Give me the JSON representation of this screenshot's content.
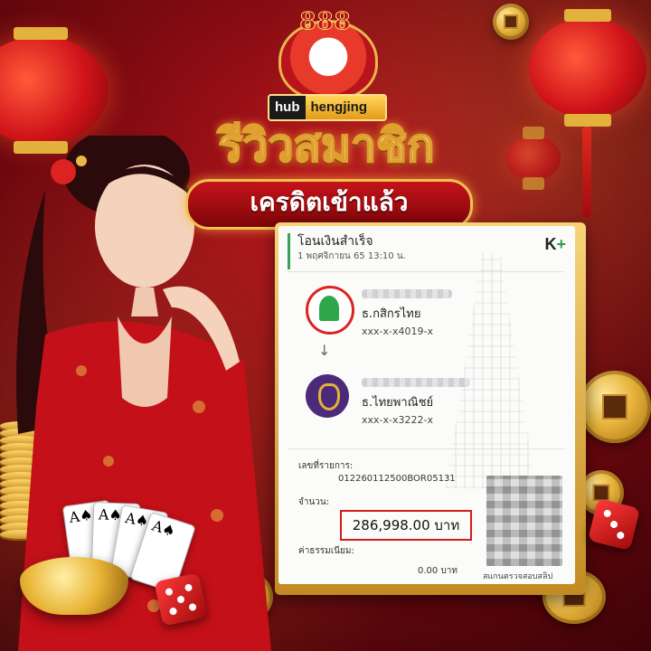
{
  "logo": {
    "badge": "888",
    "hub": "hub",
    "brand": "hengjing"
  },
  "headline": {
    "title": "รีวิวสมาชิก",
    "subtitle": "เครดิตเข้าแล้ว"
  },
  "slip": {
    "title": "โอนเงินสำเร็จ",
    "date": "1 พฤศจิกายน 65 13:10 น.",
    "app_logo": {
      "k": "K",
      "plus": "+"
    },
    "from": {
      "bank": "ธ.กสิกรไทย",
      "account": "xxx-x-x4019-x",
      "icon": "kasikorn-bank-icon"
    },
    "arrow": "↓",
    "to": {
      "bank": "ธ.ไทยพาณิชย์",
      "account": "xxx-x-x3222-x",
      "icon": "scb-bank-icon"
    },
    "ref_label": "เลขที่รายการ:",
    "ref_value": "012260112500BOR05131",
    "amount_label": "จำนวน:",
    "amount_value": "286,998.00 บาท",
    "fee_label": "ค่าธรรมเนียม:",
    "fee_value": "0.00 บาท",
    "qr_label": "สแกนตรวจสอบสลิป"
  },
  "cards": [
    "A♠",
    "A♠",
    "A♠",
    "A♠"
  ],
  "colors": {
    "accent_gold": "#e8b84a",
    "bg_red": "#b8141c",
    "kplus_green": "#2f9e4d",
    "highlight_red": "#d41c1c"
  }
}
